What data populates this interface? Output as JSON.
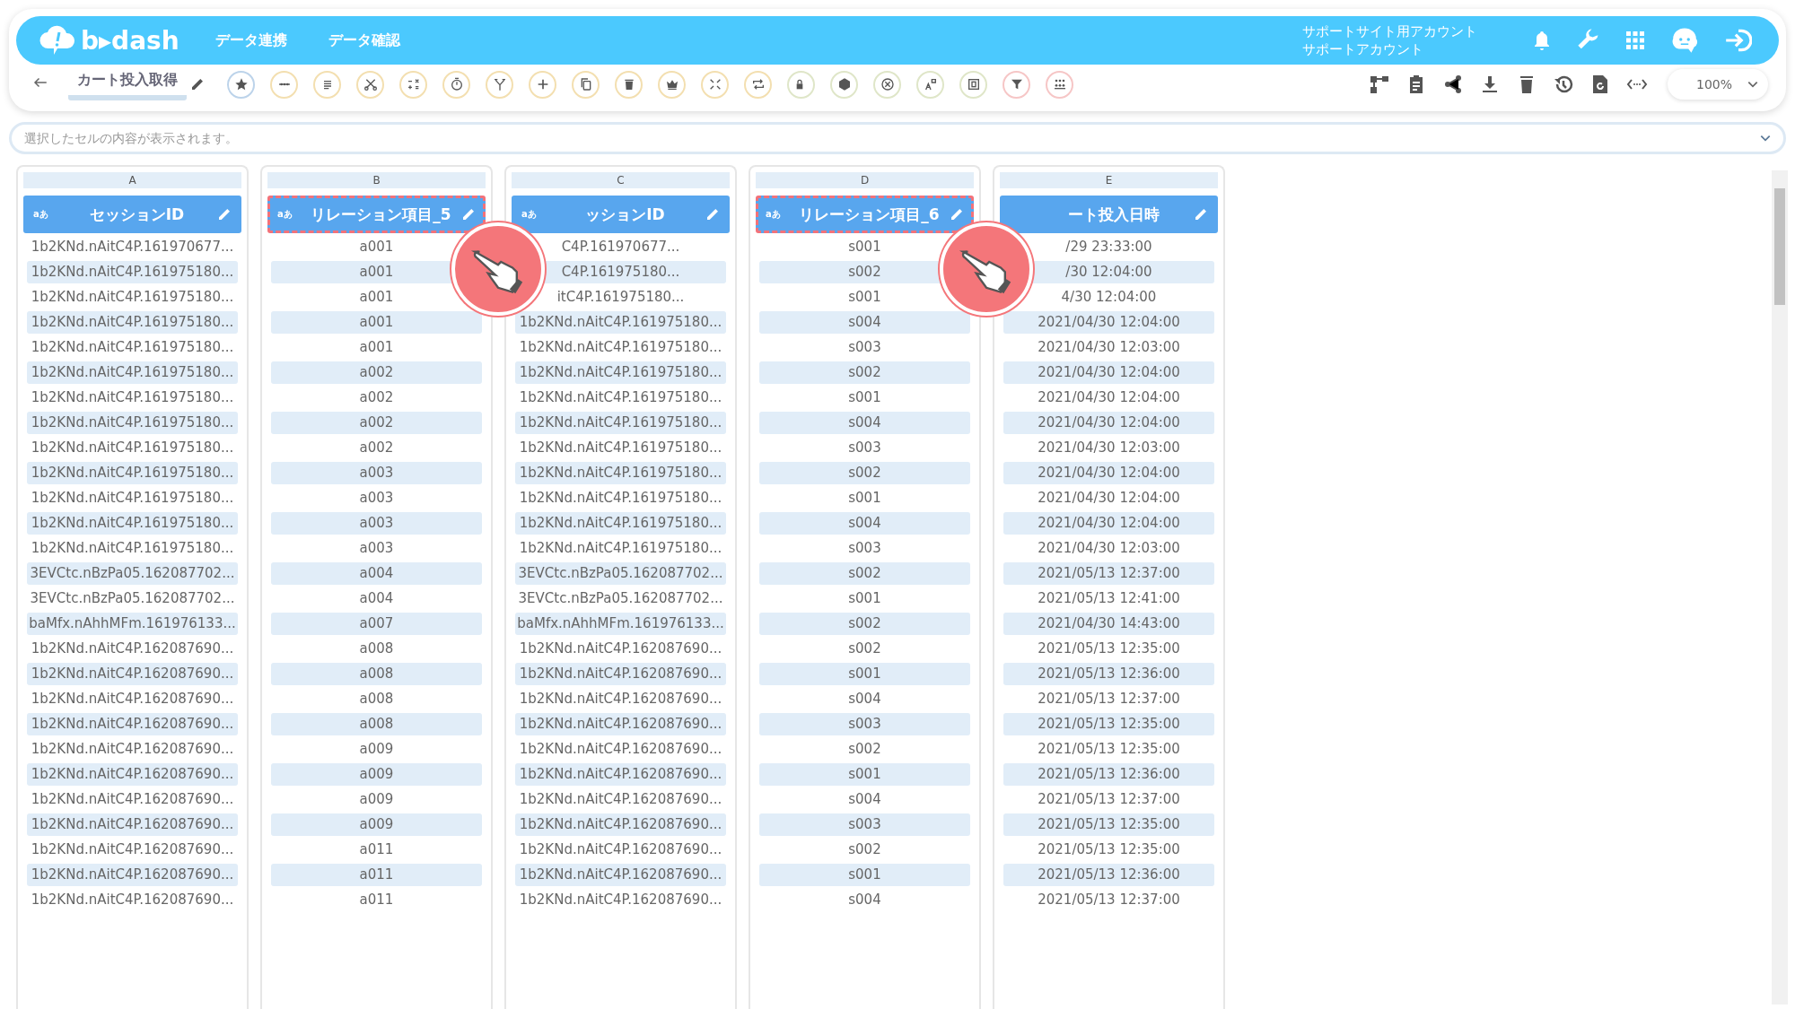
{
  "header": {
    "logo": "b▸dash",
    "nav": [
      "データ連携",
      "データ確認"
    ],
    "account": {
      "site": "サポートサイト用アカウント",
      "user": "サポートアカウント"
    }
  },
  "toolbar": {
    "title": "カート投入取得",
    "zoom": "100%"
  },
  "cell_bar": {
    "placeholder": "選択したセルの内容が表示されます。"
  },
  "columns": [
    {
      "letter": "A",
      "type_badge": "aあ",
      "name": "セッションID",
      "highlighted": false
    },
    {
      "letter": "B",
      "type_badge": "aあ",
      "name": "リレーション項目_5",
      "highlighted": true
    },
    {
      "letter": "C",
      "type_badge": "aあ",
      "name": "ッションID",
      "highlighted": false
    },
    {
      "letter": "D",
      "type_badge": "aあ",
      "name": "リレーション項目_6",
      "highlighted": true
    },
    {
      "letter": "E",
      "name": "ート投入日時",
      "highlighted": false
    }
  ],
  "rows": [
    [
      "1b2KNd.nAitC4P.161970677...",
      "a001",
      "C4P.161970677...",
      "s001",
      "/29 23:33:00"
    ],
    [
      "1b2KNd.nAitC4P.161975180...",
      "a001",
      "C4P.161975180...",
      "s002",
      "/30 12:04:00"
    ],
    [
      "1b2KNd.nAitC4P.161975180...",
      "a001",
      "itC4P.161975180...",
      "s001",
      "4/30 12:04:00"
    ],
    [
      "1b2KNd.nAitC4P.161975180...",
      "a001",
      "1b2KNd.nAitC4P.161975180...",
      "s004",
      "2021/04/30 12:04:00"
    ],
    [
      "1b2KNd.nAitC4P.161975180...",
      "a001",
      "1b2KNd.nAitC4P.161975180...",
      "s003",
      "2021/04/30 12:03:00"
    ],
    [
      "1b2KNd.nAitC4P.161975180...",
      "a002",
      "1b2KNd.nAitC4P.161975180...",
      "s002",
      "2021/04/30 12:04:00"
    ],
    [
      "1b2KNd.nAitC4P.161975180...",
      "a002",
      "1b2KNd.nAitC4P.161975180...",
      "s001",
      "2021/04/30 12:04:00"
    ],
    [
      "1b2KNd.nAitC4P.161975180...",
      "a002",
      "1b2KNd.nAitC4P.161975180...",
      "s004",
      "2021/04/30 12:04:00"
    ],
    [
      "1b2KNd.nAitC4P.161975180...",
      "a002",
      "1b2KNd.nAitC4P.161975180...",
      "s003",
      "2021/04/30 12:03:00"
    ],
    [
      "1b2KNd.nAitC4P.161975180...",
      "a003",
      "1b2KNd.nAitC4P.161975180...",
      "s002",
      "2021/04/30 12:04:00"
    ],
    [
      "1b2KNd.nAitC4P.161975180...",
      "a003",
      "1b2KNd.nAitC4P.161975180...",
      "s001",
      "2021/04/30 12:04:00"
    ],
    [
      "1b2KNd.nAitC4P.161975180...",
      "a003",
      "1b2KNd.nAitC4P.161975180...",
      "s004",
      "2021/04/30 12:04:00"
    ],
    [
      "1b2KNd.nAitC4P.161975180...",
      "a003",
      "1b2KNd.nAitC4P.161975180...",
      "s003",
      "2021/04/30 12:03:00"
    ],
    [
      "3EVCtc.nBzPa05.162087702...",
      "a004",
      "3EVCtc.nBzPa05.162087702...",
      "s002",
      "2021/05/13 12:37:00"
    ],
    [
      "3EVCtc.nBzPa05.162087702...",
      "a004",
      "3EVCtc.nBzPa05.162087702...",
      "s001",
      "2021/05/13 12:41:00"
    ],
    [
      "baMfx.nAhhMFm.161976133...",
      "a007",
      "baMfx.nAhhMFm.161976133...",
      "s002",
      "2021/04/30 14:43:00"
    ],
    [
      "1b2KNd.nAitC4P.162087690...",
      "a008",
      "1b2KNd.nAitC4P.162087690...",
      "s002",
      "2021/05/13 12:35:00"
    ],
    [
      "1b2KNd.nAitC4P.162087690...",
      "a008",
      "1b2KNd.nAitC4P.162087690...",
      "s001",
      "2021/05/13 12:36:00"
    ],
    [
      "1b2KNd.nAitC4P.162087690...",
      "a008",
      "1b2KNd.nAitC4P.162087690...",
      "s004",
      "2021/05/13 12:37:00"
    ],
    [
      "1b2KNd.nAitC4P.162087690...",
      "a008",
      "1b2KNd.nAitC4P.162087690...",
      "s003",
      "2021/05/13 12:35:00"
    ],
    [
      "1b2KNd.nAitC4P.162087690...",
      "a009",
      "1b2KNd.nAitC4P.162087690...",
      "s002",
      "2021/05/13 12:35:00"
    ],
    [
      "1b2KNd.nAitC4P.162087690...",
      "a009",
      "1b2KNd.nAitC4P.162087690...",
      "s001",
      "2021/05/13 12:36:00"
    ],
    [
      "1b2KNd.nAitC4P.162087690...",
      "a009",
      "1b2KNd.nAitC4P.162087690...",
      "s004",
      "2021/05/13 12:37:00"
    ],
    [
      "1b2KNd.nAitC4P.162087690...",
      "a009",
      "1b2KNd.nAitC4P.162087690...",
      "s003",
      "2021/05/13 12:35:00"
    ],
    [
      "1b2KNd.nAitC4P.162087690...",
      "a011",
      "1b2KNd.nAitC4P.162087690...",
      "s002",
      "2021/05/13 12:35:00"
    ],
    [
      "1b2KNd.nAitC4P.162087690...",
      "a011",
      "1b2KNd.nAitC4P.162087690...",
      "s001",
      "2021/05/13 12:36:00"
    ],
    [
      "1b2KNd.nAitC4P.162087690...",
      "a011",
      "1b2KNd.nAitC4P.162087690...",
      "s004",
      "2021/05/13 12:37:00"
    ]
  ]
}
